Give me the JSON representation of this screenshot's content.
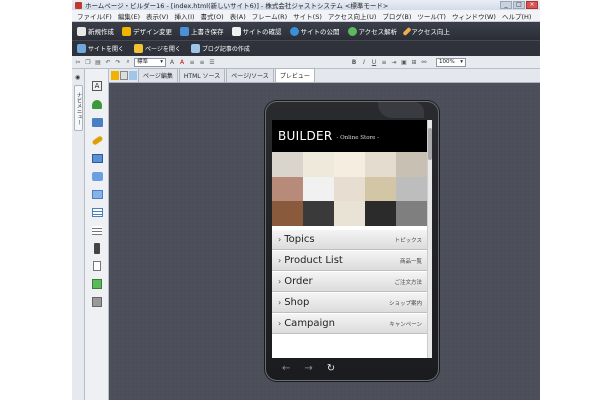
{
  "window": {
    "title": "ホームページ・ビルダー16 - [index.html(新しいサイト6)] - 株式会社ジャストシステム <標準モード>",
    "buttons": [
      "_",
      "□",
      "×"
    ]
  },
  "menubar": [
    "ファイル(F)",
    "編集(E)",
    "表示(V)",
    "挿入(I)",
    "書式(O)",
    "表(A)",
    "フレーム(R)",
    "サイト(S)",
    "アクセス向上(U)",
    "ブログ(B)",
    "ツール(T)",
    "ウィンドウ(W)",
    "ヘルプ(H)"
  ],
  "toolbar_main": [
    {
      "label": "新規作成",
      "icon": "new-document-icon",
      "color": "#e8e8e8"
    },
    {
      "label": "デザイン変更",
      "icon": "design-icon",
      "color": "#f0b400"
    },
    {
      "label": "上書き保存",
      "icon": "save-icon",
      "color": "#4a90d9"
    },
    {
      "label": "サイトの確認",
      "icon": "site-check-icon",
      "color": "#f0f0f0"
    },
    {
      "label": "サイトの公開",
      "icon": "globe-icon",
      "color": "#3a8fd9"
    },
    {
      "label": "アクセス解析",
      "icon": "analytics-icon",
      "color": "#5cb85c"
    },
    {
      "label": "アクセス向上",
      "icon": "pencil-icon",
      "color": "#f0ad4e"
    }
  ],
  "toolbar_sub": [
    {
      "label": "サイトを開く",
      "icon": "open-site-icon"
    },
    {
      "label": "ページを開く",
      "icon": "open-page-icon"
    },
    {
      "label": "ブログ記事の作成",
      "icon": "blog-icon"
    }
  ],
  "formatbar": {
    "style_select": "標準",
    "zoom_select": "100%"
  },
  "sidebar": {
    "vertical_tab": "ナビメニュー"
  },
  "tabs": [
    "ページ編集",
    "HTML ソース",
    "ページ/ソース",
    "プレビュー"
  ],
  "preview": {
    "brand": "BUILDER",
    "subtitle": "- Online Store -",
    "photo_colors": [
      "#d9d4cc",
      "#efe9dc",
      "#f4ede0",
      "#e3dccf",
      "#c9c0b4",
      "#b88a7a",
      "#f1f1f1",
      "#e7ddd0",
      "#d2c6a6",
      "#bdbdbd",
      "#8a5a3c",
      "#3a3a3a",
      "#e9e3d6",
      "#2b2b2b",
      "#7f7f7f"
    ],
    "menu": [
      {
        "en": "Topics",
        "jp": "トピックス"
      },
      {
        "en": "Product List",
        "jp": "商品一覧"
      },
      {
        "en": "Order",
        "jp": "ご注文方法"
      },
      {
        "en": "Shop",
        "jp": "ショップ案内"
      },
      {
        "en": "Campaign",
        "jp": "キャンペーン"
      }
    ],
    "nav": {
      "back": "←",
      "forward": "→",
      "reload": "↻"
    }
  }
}
